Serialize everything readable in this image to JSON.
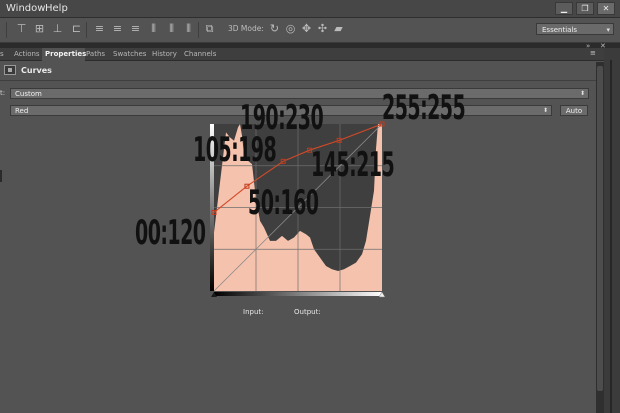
{
  "menu": {
    "window": "Window",
    "help": "Help"
  },
  "window_controls": {
    "minimize": "▁",
    "restore": "❐",
    "close": "✕"
  },
  "options_bar": {
    "mode_3d_label": "3D Mode:",
    "workspace": "Essentials",
    "icons": [
      "align-top-icon",
      "align-vcenter-icon",
      "align-bottom-icon",
      "align-left-icon",
      "align-hcenter-icon",
      "align-right-icon",
      "distribute-top-icon",
      "distribute-vcenter-icon",
      "distribute-bottom-icon",
      "distribute-left-icon",
      "distribute-hcenter-icon",
      "distribute-right-icon",
      "auto-align-icon",
      "rotate-3d-icon",
      "roll-3d-icon",
      "pan-3d-icon",
      "slide-3d-icon",
      "scale-3d-icon"
    ]
  },
  "tabs": [
    {
      "label": "Actions"
    },
    {
      "label": "Properties",
      "active": true
    },
    {
      "label": "Paths"
    },
    {
      "label": "Swatches"
    },
    {
      "label": "History"
    },
    {
      "label": "Channels"
    }
  ],
  "panel": {
    "title": "Curves",
    "preset_label": "t:",
    "preset_value": "Custom",
    "channel_value": "Red",
    "auto_label": "Auto",
    "input_label": "Input:",
    "output_label": "Output:"
  },
  "colors": {
    "histogram_fill": "#f7c4b0",
    "histogram_dark": "#3d3d3d",
    "curve": "#d44a2a"
  },
  "curve_points": [
    {
      "in": 0,
      "out": 120
    },
    {
      "in": 50,
      "out": 160
    },
    {
      "in": 105,
      "out": 198
    },
    {
      "in": 145,
      "out": 215
    },
    {
      "in": 190,
      "out": 230
    },
    {
      "in": 255,
      "out": 255
    }
  ],
  "annotations": [
    {
      "text": "00:120"
    },
    {
      "text": "50:160"
    },
    {
      "text": "105:198"
    },
    {
      "text": "145:215"
    },
    {
      "text": "190:230"
    },
    {
      "text": "255:255"
    }
  ]
}
